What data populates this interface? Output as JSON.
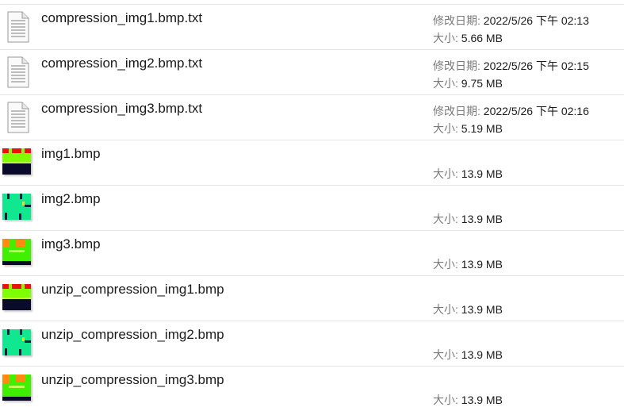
{
  "labels": {
    "modified": "修改日期:",
    "size": "大小:"
  },
  "files": [
    {
      "name": "compression_img1.bmp.txt",
      "type": "text",
      "modified": "2022/5/26 下午 02:13",
      "size": "5.66 MB"
    },
    {
      "name": "compression_img2.bmp.txt",
      "type": "text",
      "modified": "2022/5/26 下午 02:15",
      "size": "9.75 MB"
    },
    {
      "name": "compression_img3.bmp.txt",
      "type": "text",
      "modified": "2022/5/26 下午 02:16",
      "size": "5.19 MB"
    },
    {
      "name": "img1.bmp",
      "type": "bmp1",
      "size": "13.9 MB"
    },
    {
      "name": "img2.bmp",
      "type": "bmp2",
      "size": "13.9 MB"
    },
    {
      "name": "img3.bmp",
      "type": "bmp3",
      "size": "13.9 MB"
    },
    {
      "name": "unzip_compression_img1.bmp",
      "type": "bmp1",
      "size": "13.9 MB"
    },
    {
      "name": "unzip_compression_img2.bmp",
      "type": "bmp2",
      "size": "13.9 MB"
    },
    {
      "name": "unzip_compression_img3.bmp",
      "type": "bmp3",
      "size": "13.9 MB"
    }
  ]
}
